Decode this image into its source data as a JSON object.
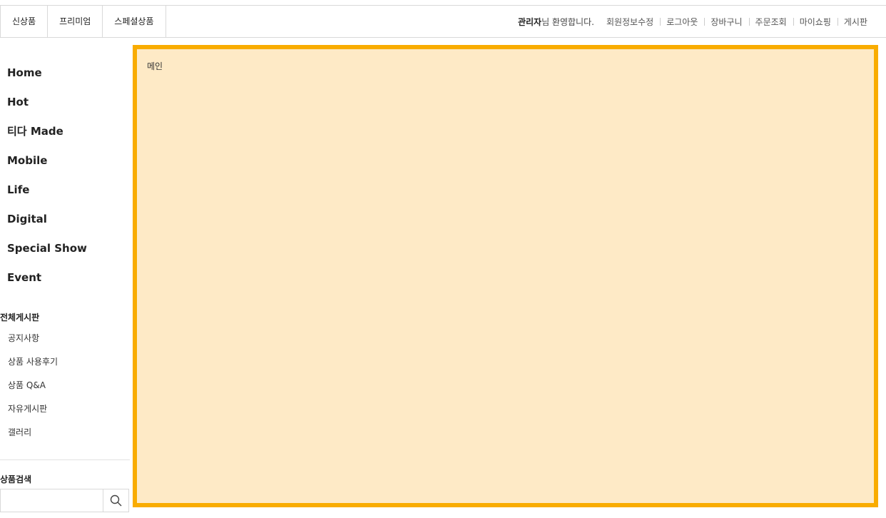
{
  "header": {
    "category_tabs": [
      "신상품",
      "프리미엄",
      "스페셜상품"
    ],
    "welcome_name": "관리자",
    "welcome_rest": "님 환영합니다.",
    "util_links": [
      "회원정보수정",
      "로그아웃",
      "장바구니",
      "주문조회",
      "마이쇼핑",
      "게시판"
    ]
  },
  "sidebar": {
    "main_menu": [
      "Home",
      "Hot",
      "티다 Made",
      "Mobile",
      "Life",
      "Digital",
      "Special Show",
      "Event"
    ],
    "board_title": "전체게시판",
    "boards": [
      "공지사항",
      "상품 사용후기",
      "상품 Q&A",
      "자유게시판",
      "갤러리"
    ],
    "search_title": "상품검색",
    "search_value": "",
    "search_icon": "search-icon"
  },
  "main": {
    "label": "메인",
    "background_color": "#feeac6",
    "border_color": "#f9ac00"
  }
}
